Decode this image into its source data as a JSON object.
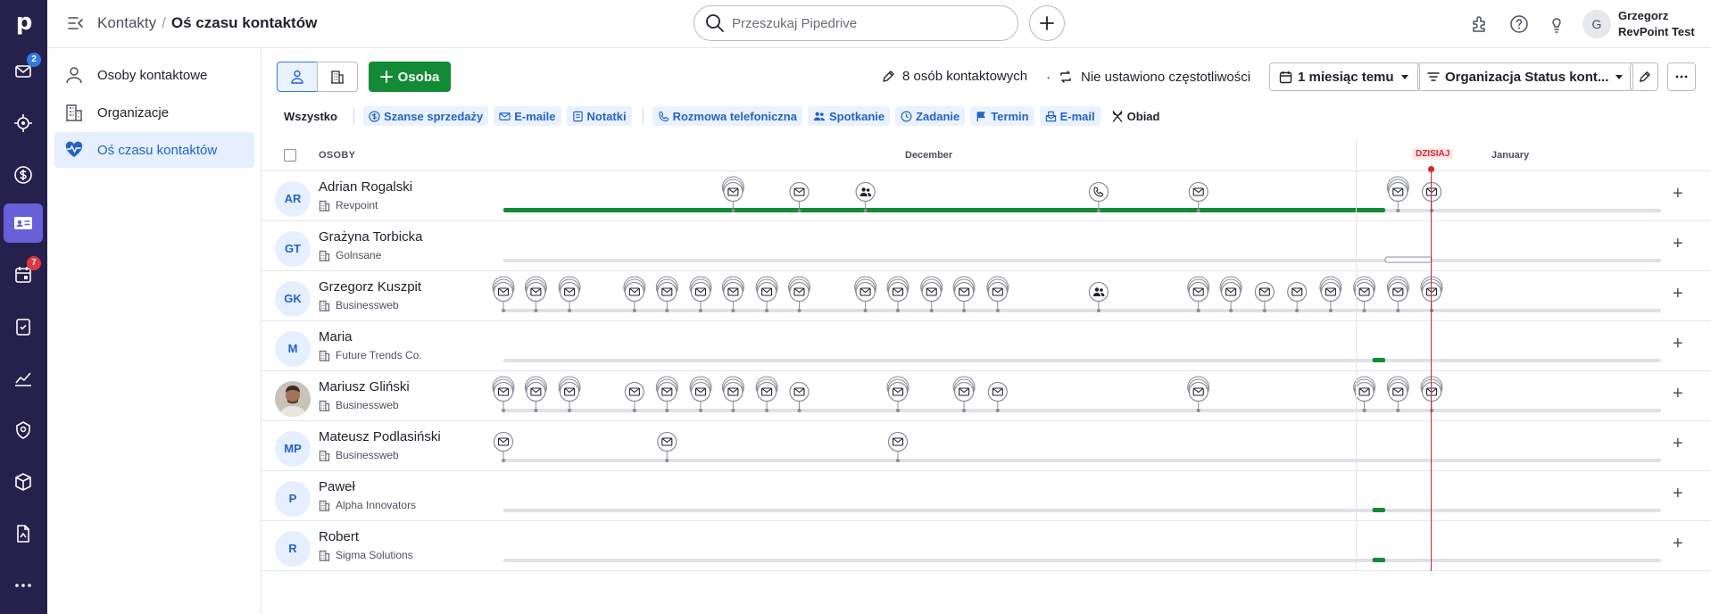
{
  "app": {
    "brand_letter": "p"
  },
  "rail": {
    "items": [
      {
        "icon": "mail-icon",
        "badge": "2",
        "badge_color": "#317ae2"
      },
      {
        "icon": "target-icon"
      },
      {
        "icon": "dollar-icon"
      },
      {
        "icon": "contacts-card-icon",
        "active": true
      },
      {
        "icon": "calendar-icon",
        "badge": "7",
        "badge_color": "#e1353f"
      },
      {
        "icon": "clipboard-check-icon"
      },
      {
        "icon": "chart-line-icon"
      },
      {
        "icon": "campaigns-icon"
      },
      {
        "icon": "box-icon"
      },
      {
        "icon": "documents-icon"
      },
      {
        "icon": "more-icon"
      }
    ]
  },
  "header": {
    "breadcrumb_parent": "Kontakty",
    "breadcrumb_sep": "/",
    "breadcrumb_current": "Oś czasu kontaktów",
    "search_placeholder": "Przeszukaj Pipedrive",
    "user_initial": "G",
    "user_name": "Grzegorz",
    "user_company": "RevPoint Test"
  },
  "sidebar": {
    "items": [
      {
        "label": "Osoby kontaktowe",
        "icon": "person-icon"
      },
      {
        "label": "Organizacje",
        "icon": "building-icon"
      },
      {
        "label": "Oś czasu kontaktów",
        "icon": "heart-pulse-icon",
        "active": true
      }
    ]
  },
  "toolbar": {
    "add_person_label": "Osoba",
    "contacts_count": "8 osób kontaktowych",
    "frequency_label": "Nie ustawiono częstotliwości",
    "period_label": "1 miesiąc temu",
    "filter_label": "Organizacja Status kont..."
  },
  "filters": {
    "all": "Wszystko",
    "chips": [
      {
        "label": "Szanse sprzedaży",
        "icon": "dollar-icon"
      },
      {
        "label": "E-maile",
        "icon": "mail-icon"
      },
      {
        "label": "Notatki",
        "icon": "note-icon"
      }
    ],
    "activity_chips": [
      {
        "label": "Rozmowa telefoniczna",
        "icon": "phone-icon"
      },
      {
        "label": "Spotkanie",
        "icon": "people-icon"
      },
      {
        "label": "Zadanie",
        "icon": "clock-icon"
      },
      {
        "label": "Termin",
        "icon": "flag-icon"
      },
      {
        "label": "E-mail",
        "icon": "mail-send-icon"
      },
      {
        "label": "Obiad",
        "icon": "cutlery-icon",
        "unselected": true
      }
    ]
  },
  "timeline": {
    "column_label": "OSOBY",
    "month_1": "December",
    "month_2": "January",
    "today_label": "DZISIAJ",
    "accent_green": "#138a36",
    "accent_red": "#d9262c",
    "rows": [
      {
        "initials": "AR",
        "name": "Adrian Rogalski",
        "org": "Revpoint",
        "events": [
          [
            0.198,
            "mail",
            true
          ],
          [
            0.255,
            "mail",
            false
          ],
          [
            0.312,
            "people",
            false
          ],
          [
            0.513,
            "phone",
            false
          ],
          [
            0.599,
            "mail",
            false
          ],
          [
            0.771,
            "mail",
            true
          ],
          [
            0.8,
            "mail",
            false
          ]
        ],
        "green_bar": [
          0,
          0.76
        ],
        "open_box": null
      },
      {
        "initials": "GT",
        "name": "Grażyna Torbicka",
        "org": "Golnsane",
        "events": [],
        "green_bar": null,
        "open_box": [
          0.76,
          0.8
        ]
      },
      {
        "initials": "GK",
        "name": "Grzegorz Kuszpit",
        "org": "Businessweb",
        "events": [
          [
            0,
            "mail",
            true
          ],
          [
            0.028,
            "mail",
            true
          ],
          [
            0.057,
            "mail",
            true
          ],
          [
            0.113,
            "mail",
            true
          ],
          [
            0.141,
            "mail",
            true
          ],
          [
            0.17,
            "mail",
            true
          ],
          [
            0.198,
            "mail",
            true
          ],
          [
            0.227,
            "mail",
            true
          ],
          [
            0.255,
            "mail",
            true
          ],
          [
            0.312,
            "mail",
            true
          ],
          [
            0.34,
            "mail",
            true
          ],
          [
            0.369,
            "mail",
            true
          ],
          [
            0.397,
            "mail",
            true
          ],
          [
            0.426,
            "mail",
            true
          ],
          [
            0.513,
            "people",
            false
          ],
          [
            0.599,
            "mail",
            true
          ],
          [
            0.627,
            "mail",
            true
          ],
          [
            0.656,
            "mail",
            false
          ],
          [
            0.684,
            "mail",
            false
          ],
          [
            0.713,
            "mail",
            true
          ],
          [
            0.742,
            "mail",
            true
          ],
          [
            0.771,
            "mail",
            true
          ],
          [
            0.8,
            "mail",
            true
          ]
        ],
        "green_bar": null,
        "open_box": null
      },
      {
        "initials": "M",
        "name": "Maria",
        "org": "Future Trends Co.",
        "events": [],
        "green_bar": [
          0.749,
          0.76
        ],
        "open_box": null
      },
      {
        "initials": "",
        "photo": true,
        "name": "Mariusz Gliński",
        "org": "Businessweb",
        "events": [
          [
            0,
            "mail",
            true
          ],
          [
            0.028,
            "mail",
            true
          ],
          [
            0.057,
            "mail",
            true
          ],
          [
            0.113,
            "mail",
            false
          ],
          [
            0.141,
            "mail",
            true
          ],
          [
            0.17,
            "mail",
            true
          ],
          [
            0.198,
            "mail",
            true
          ],
          [
            0.227,
            "mail",
            true
          ],
          [
            0.255,
            "mail",
            false
          ],
          [
            0.34,
            "mail",
            true
          ],
          [
            0.397,
            "mail",
            true
          ],
          [
            0.426,
            "mail",
            false
          ],
          [
            0.599,
            "mail",
            true
          ],
          [
            0.742,
            "mail",
            true
          ],
          [
            0.771,
            "mail",
            true
          ],
          [
            0.8,
            "mail",
            true
          ]
        ],
        "green_bar": null,
        "open_box": null
      },
      {
        "initials": "MP",
        "name": "Mateusz Podlasiński",
        "org": "Businessweb",
        "events": [
          [
            0,
            "mail",
            false
          ],
          [
            0.141,
            "mail",
            false
          ],
          [
            0.34,
            "mail",
            false
          ]
        ],
        "green_bar": null,
        "open_box": null
      },
      {
        "initials": "P",
        "name": "Paweł",
        "org": "Alpha Innovators",
        "events": [],
        "green_bar": [
          0.749,
          0.76
        ],
        "open_box": null
      },
      {
        "initials": "R",
        "name": "Robert",
        "org": "Sigma Solutions",
        "events": [],
        "green_bar": [
          0.749,
          0.76
        ],
        "open_box": null
      }
    ]
  }
}
